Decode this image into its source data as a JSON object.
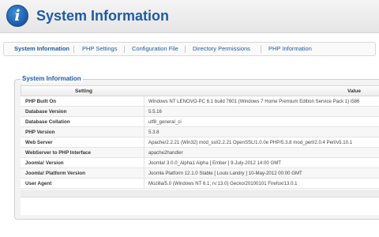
{
  "header": {
    "title": "System Information",
    "logo_glyph": "i",
    "logo_icon": "info-icon"
  },
  "tabs": [
    {
      "label": "System Information",
      "active": true
    },
    {
      "label": "PHP Settings"
    },
    {
      "label": "Configuration File"
    },
    {
      "label": "Directory Permissions"
    },
    {
      "label": "PHP Information"
    }
  ],
  "panel": {
    "legend": "System Information"
  },
  "table": {
    "col_setting": "Setting",
    "col_value": "Value",
    "rows": [
      {
        "setting": "PHP Built On",
        "value": "Windows NT LENOVO-PC 6.1 build 7601 (Windows 7 Home Premium Edition Service Pack 1) i586"
      },
      {
        "setting": "Database Version",
        "value": "5.5.16"
      },
      {
        "setting": "Database Collation",
        "value": "utf8_general_ci"
      },
      {
        "setting": "PHP Version",
        "value": "5.3.8"
      },
      {
        "setting": "Web Server",
        "value": "Apache/2.2.21 (Win32) mod_ssl/2.2.21 OpenSSL/1.0.0e PHP/5.3.8 mod_perl/2.0.4 Perl/v5.10.1"
      },
      {
        "setting": "WebServer to PHP Interface",
        "value": "apache2handler"
      },
      {
        "setting": "Joomla! Version",
        "value": "Joomla! 3.0.0_Alpha1 Alpha [ Ember ] 9-July-2012 14:00 GMT"
      },
      {
        "setting": "Joomla! Platform Version",
        "value": "Joomla Platform 12.1.0 Stable [ Louis Landry ] 10-May-2012 00:00 GMT"
      },
      {
        "setting": "User Agent",
        "value": "Mozilla/5.0 (Windows NT 6.1; rv:13.0) Gecko/20100101 Firefox/13.0.1"
      }
    ]
  },
  "colors": {
    "accent": "#1d5ba5",
    "header_bg": "#eeeeee"
  }
}
